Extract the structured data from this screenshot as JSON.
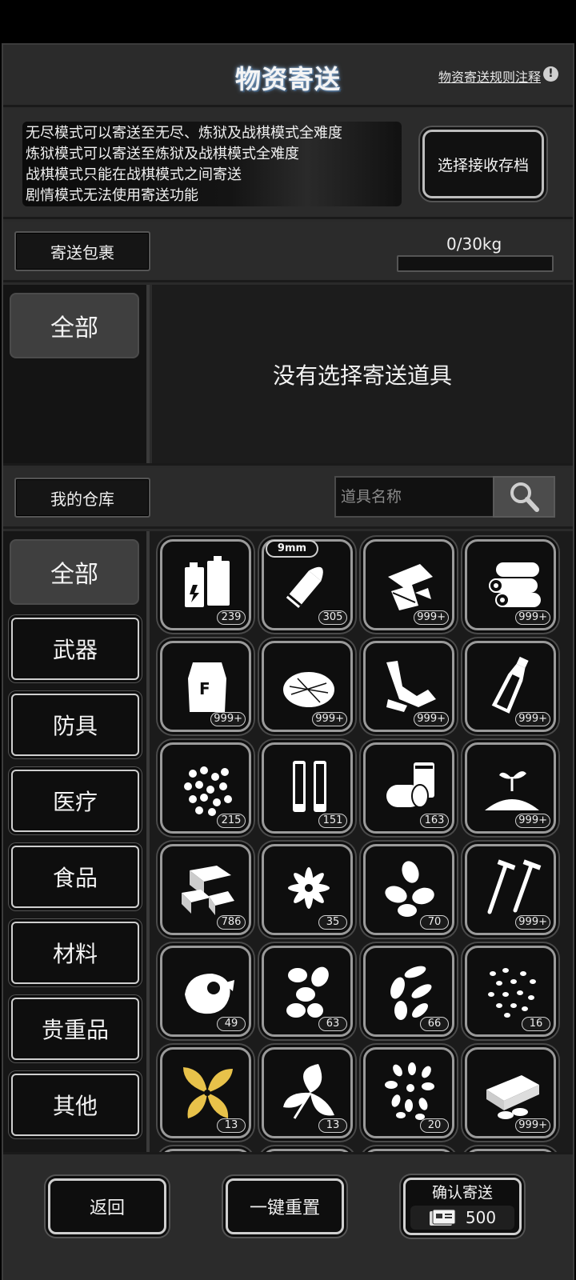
{
  "header": {
    "title": "物资寄送",
    "rules_link": "物资寄送规则注释",
    "rules_icon": "!"
  },
  "info": {
    "lines": [
      "无尽模式可以寄送至无尽、炼狱及战棋模式全难度",
      "炼狱模式可以寄送至炼狱及战棋模式全难度",
      "战棋模式只能在战棋模式之间寄送",
      "剧情模式无法使用寄送功能"
    ],
    "select_save_label": "选择接收存档"
  },
  "parcel": {
    "label": "寄送包裹",
    "weight_text": "0/30kg",
    "weight_fraction": 0
  },
  "parcel_area": {
    "category": "全部",
    "empty_message": "没有选择寄送道具"
  },
  "warehouse": {
    "label": "我的仓库",
    "search_placeholder": "道具名称",
    "categories": [
      "全部",
      "武器",
      "防具",
      "医疗",
      "食品",
      "材料",
      "贵重品",
      "其他"
    ],
    "items": [
      {
        "icon": "battery-icon",
        "count": "239"
      },
      {
        "icon": "bullet-9mm-icon",
        "count": "305",
        "tag": "9mm"
      },
      {
        "icon": "paper-scraps-icon",
        "count": "999+"
      },
      {
        "icon": "logs-icon",
        "count": "999+"
      },
      {
        "icon": "flour-bag-icon",
        "count": "999+"
      },
      {
        "icon": "fiber-pile-icon",
        "count": "999+"
      },
      {
        "icon": "cloth-scraps-icon",
        "count": "999+"
      },
      {
        "icon": "bottle-icon",
        "count": "999+"
      },
      {
        "icon": "beans-icon",
        "count": "215"
      },
      {
        "icon": "shotgun-shells-icon",
        "count": "151"
      },
      {
        "icon": "cans-icon",
        "count": "163"
      },
      {
        "icon": "seedling-soil-icon",
        "count": "999+"
      },
      {
        "icon": "wood-blocks-icon",
        "count": "786"
      },
      {
        "icon": "star-anise-icon",
        "count": "35"
      },
      {
        "icon": "almonds-icon",
        "count": "70"
      },
      {
        "icon": "nails-icon",
        "count": "999+"
      },
      {
        "icon": "onion-icon",
        "count": "49"
      },
      {
        "icon": "nuts-icon",
        "count": "63"
      },
      {
        "icon": "seeds-icon",
        "count": "66"
      },
      {
        "icon": "small-seeds-icon",
        "count": "16"
      },
      {
        "icon": "tobacco-leaf-icon",
        "count": "13",
        "color": "#e8c24a"
      },
      {
        "icon": "herb-leaf-icon",
        "count": "13"
      },
      {
        "icon": "seed-mix-icon",
        "count": "20"
      },
      {
        "icon": "tofu-icon",
        "count": "999+"
      }
    ]
  },
  "bottom": {
    "back_label": "返回",
    "reset_label": "一键重置",
    "confirm_label": "确认寄送",
    "cost": "500"
  }
}
